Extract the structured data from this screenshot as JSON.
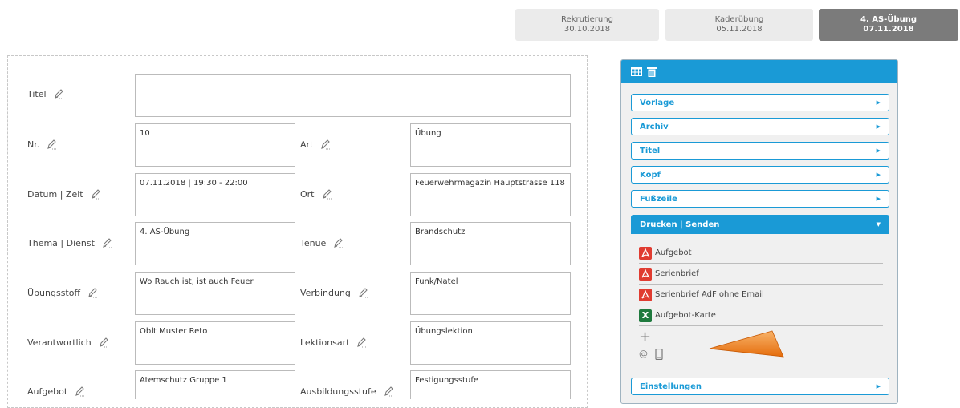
{
  "tabs": [
    {
      "name": "Rekrutierung",
      "date": "30.10.2018"
    },
    {
      "name": "Kaderübung",
      "date": "05.11.2018"
    },
    {
      "name": "4. AS-Übung",
      "date": "07.11.2018"
    }
  ],
  "form": {
    "titel_label": "Titel",
    "titel_value": "",
    "nr_label": "Nr.",
    "nr_value": "10",
    "art_label": "Art",
    "art_value": "Übung",
    "datum_label": "Datum | Zeit",
    "datum_value": "07.11.2018 | 19:30 - 22:00",
    "ort_label": "Ort",
    "ort_value": "Feuerwehrmagazin Hauptstrasse 118",
    "thema_label": "Thema | Dienst",
    "thema_value": "4. AS-Übung",
    "tenue_label": "Tenue",
    "tenue_value": "Brandschutz",
    "stoff_label": "Übungsstoff",
    "stoff_value": "Wo Rauch ist, ist auch Feuer",
    "verbindung_label": "Verbindung",
    "verbindung_value": "Funk/Natel",
    "verantwortlich_label": "Verantwortlich",
    "verantwortlich_value": "Oblt Muster Reto",
    "lektionsart_label": "Lektionsart",
    "lektionsart_value": "Übungslektion",
    "aufgebot_label": "Aufgebot",
    "aufgebot_value": "Atemschutz Gruppe 1",
    "ausbildung_label": "Ausbildungsstufe",
    "ausbildung_value": "Festigungsstufe"
  },
  "panel": {
    "sections": [
      "Vorlage",
      "Archiv",
      "Titel",
      "Kopf",
      "Fußzeile"
    ],
    "open_section": "Drucken | Senden",
    "documents": [
      {
        "label": "Aufgebot",
        "type": "pdf"
      },
      {
        "label": "Serienbrief",
        "type": "pdf"
      },
      {
        "label": "Serienbrief AdF ohne Email",
        "type": "pdf"
      },
      {
        "label": "Aufgebot-Karte",
        "type": "xls"
      }
    ],
    "add_symbol": "+",
    "at_symbol": "@",
    "settings_section": "Einstellungen"
  },
  "colors": {
    "accent": "#1a9ad6",
    "tab_active": "#7b7b7b",
    "pdf": "#e03c31",
    "excel": "#1f7a3e",
    "pointer_arrow": "#f08a24"
  }
}
